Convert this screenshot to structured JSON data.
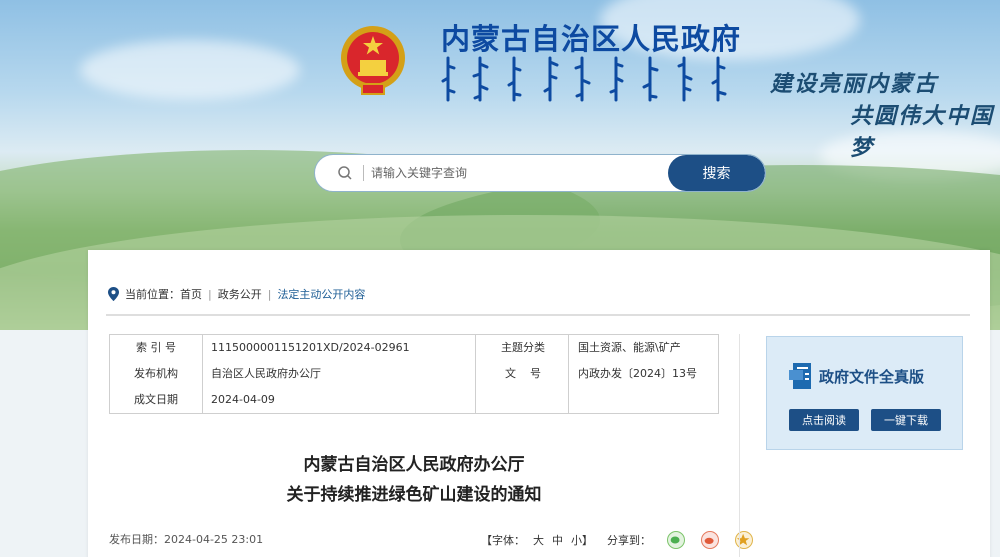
{
  "header": {
    "site_title": "内蒙古自治区人民政府",
    "slogan_line1": "建设亮丽内蒙古",
    "slogan_line2": "共圆伟大中国梦"
  },
  "search": {
    "placeholder": "请输入关键字查询",
    "button_label": "搜索"
  },
  "breadcrumb": {
    "prefix": "当前位置：",
    "items": [
      "首页",
      "政务公开",
      "法定主动公开内容"
    ],
    "separator": "|"
  },
  "meta": {
    "index_label": "索 引 号",
    "index_value": "11150000011512​01XD/2024-02961",
    "topic_label": "主题分类",
    "topic_value": "国土资源、能源\\矿产",
    "issuer_label": "发布机构",
    "issuer_value": "自治区人民政府办公厅",
    "docno_label": "文    号",
    "docno_value": "内政办发〔2024〕13号",
    "date_label": "成文日期",
    "date_value": "2024-04-09"
  },
  "document": {
    "title_line1": "内蒙古自治区人民政府办公厅",
    "title_line2": "关于持续推进绿色矿山建设的通知",
    "publish_label": "发布日期：",
    "publish_date": "2024-04-25 23:01",
    "font_label": "【字体：",
    "font_large": "大",
    "font_medium": "中",
    "font_small": "小】",
    "share_label": "分享到："
  },
  "side_panel": {
    "title": "政府文件全真版",
    "read_button": "点击阅读",
    "download_button": "一键下载"
  },
  "colors": {
    "brand_blue": "#1d4f86",
    "title_blue": "#0d4aa1"
  }
}
